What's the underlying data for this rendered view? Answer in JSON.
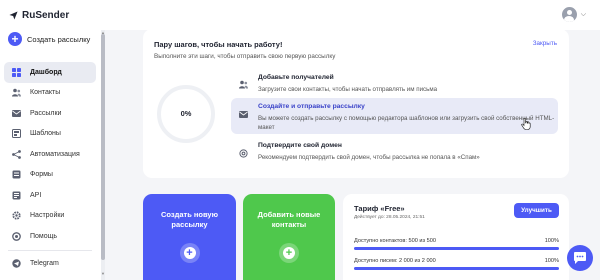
{
  "app": {
    "logo_text": "RuSender"
  },
  "sidebar": {
    "create_label": "Создать рассылку",
    "items": [
      {
        "label": "Дашборд",
        "icon": "grid-icon",
        "active": true
      },
      {
        "label": "Контакты",
        "icon": "contacts-icon"
      },
      {
        "label": "Рассылки",
        "icon": "mailings-icon"
      },
      {
        "label": "Шаблоны",
        "icon": "templates-icon"
      },
      {
        "label": "Автоматизация",
        "icon": "automation-icon"
      },
      {
        "label": "Формы",
        "icon": "forms-icon"
      },
      {
        "label": "API",
        "icon": "api-icon"
      },
      {
        "label": "Настройки",
        "icon": "settings-icon"
      },
      {
        "label": "Помощь",
        "icon": "help-icon"
      },
      {
        "label": "Telegram",
        "icon": "telegram-icon"
      }
    ]
  },
  "onboarding": {
    "title": "Пару шагов, чтобы начать работу!",
    "subtitle": "Выполните эти шаги, чтобы отправить свою первую рассылку",
    "close_label": "Закрыть",
    "progress_text": "0%",
    "progress_value": 0,
    "steps": [
      {
        "title": "Добавьте получателей",
        "desc": "Загрузите свои контакты, чтобы начать отправлять им письма",
        "icon": "contacts-icon"
      },
      {
        "title": "Создайте и отправьте рассылку",
        "desc": "Вы можете создать рассылку с помощью редактора шаблонов или загрузить свой собственный HTML-макет",
        "icon": "mailings-icon",
        "highlighted": true
      },
      {
        "title": "Подтвердите свой домен",
        "desc": "Рекомендуем подтвердить свой домен, чтобы рассылка не попала в «Спам»",
        "icon": "at-icon"
      }
    ]
  },
  "cards": {
    "create_title": "Создать новую рассылку",
    "add_title": "Добавить новые контакты"
  },
  "tariff": {
    "title": "Тариф «Free»",
    "valid_until": "Действует до: 28.05.2024, 21:51",
    "upgrade_label": "Улучшить",
    "contacts_label": "Доступно контактов: 500 из 500",
    "contacts_pct": "100%",
    "contacts_fraction": 1.0,
    "letters_label": "Доступно писем: 2 000 из 2 000",
    "letters_pct": "100%",
    "letters_fraction": 1.0
  },
  "colors": {
    "accent": "#4d5af5",
    "green": "#4fc84c",
    "highlight": "#e8eaf7"
  }
}
